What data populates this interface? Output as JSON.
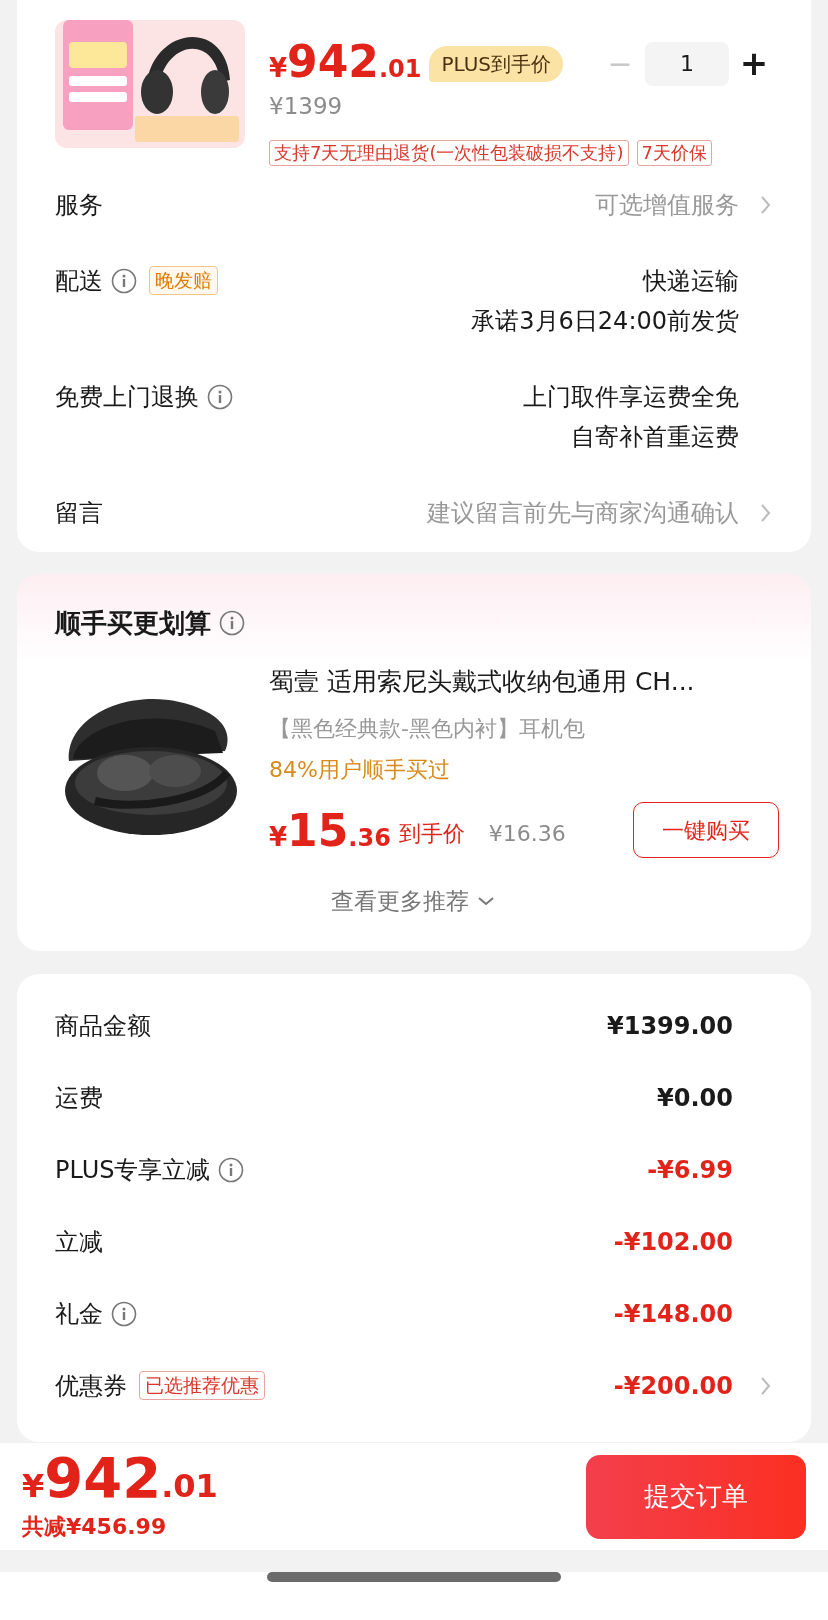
{
  "product": {
    "price": {
      "currency": "¥",
      "integer": "942",
      "decimal": ".01"
    },
    "price_badge": "PLUS到手价",
    "original_price": "¥1399",
    "quantity": {
      "decrement": "−",
      "value": "1",
      "increment": "+",
      "decrement_disabled": true
    },
    "tags": [
      "支持7天无理由退货(一次性包装破损不支持)",
      "7天价保"
    ]
  },
  "details": [
    {
      "label": "服务",
      "info": false,
      "values": [
        "可选增值服务"
      ],
      "muted": true,
      "chevron": true
    },
    {
      "label": "配送",
      "info": true,
      "badge": "晚发赔",
      "values": [
        "快递运输",
        "承诺3月6日24:00前发货"
      ],
      "muted": false,
      "chevron": false
    },
    {
      "label": "免费上门退换",
      "info": true,
      "values": [
        "上门取件享运费全免",
        "自寄补首重运费"
      ],
      "muted": false,
      "chevron": false
    },
    {
      "label": "留言",
      "info": false,
      "values": [
        "建议留言前先与商家沟通确认"
      ],
      "muted": true,
      "chevron": true
    }
  ],
  "recommend": {
    "title": "顺手买更划算",
    "item": {
      "title": "蜀壹 适用索尼头戴式收纳包通用 CH...",
      "spec": "【黑色经典款-黑色内衬】耳机包",
      "social": "84%用户顺手买过",
      "price": {
        "currency": "¥",
        "integer": "15",
        "decimal": ".36"
      },
      "price_label": "到手价",
      "original_price": "¥16.36",
      "button": "一键购买"
    },
    "more": "查看更多推荐"
  },
  "summary": [
    {
      "label": "商品金额",
      "info": false,
      "value": "¥1399.00",
      "discount": false,
      "chevron": false
    },
    {
      "label": "运费",
      "info": false,
      "value": "¥0.00",
      "discount": false,
      "chevron": false
    },
    {
      "label": "PLUS专享立减",
      "info": true,
      "value": "-¥6.99",
      "discount": true,
      "chevron": false
    },
    {
      "label": "立减",
      "info": false,
      "value": "-¥102.00",
      "discount": true,
      "chevron": false
    },
    {
      "label": "礼金",
      "info": true,
      "value": "-¥148.00",
      "discount": true,
      "chevron": false
    },
    {
      "label": "优惠券",
      "info": false,
      "badge": "已选推荐优惠",
      "value": "-¥200.00",
      "discount": true,
      "chevron": true
    }
  ],
  "footer": {
    "total": {
      "currency": "¥",
      "integer": "942",
      "decimal": ".01"
    },
    "saved": "共减¥456.99",
    "submit": "提交订单"
  }
}
